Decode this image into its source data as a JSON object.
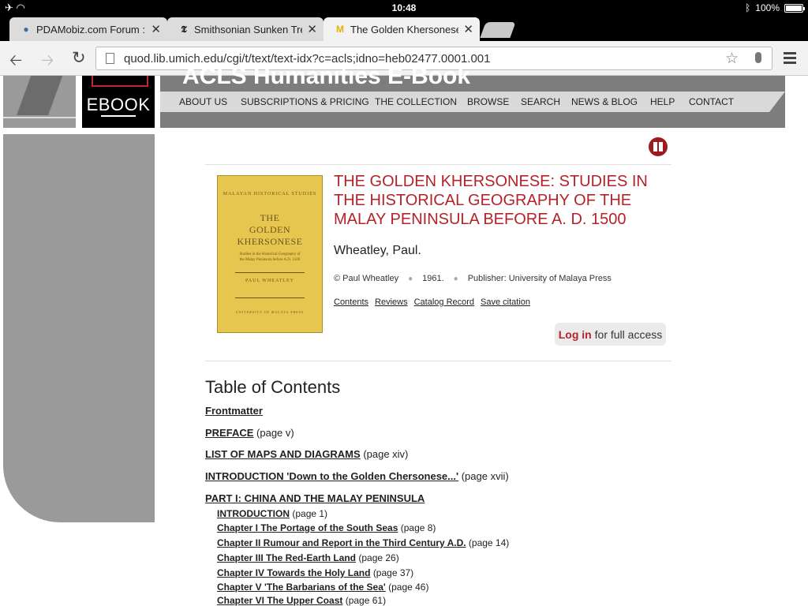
{
  "status_bar": {
    "time": "10:48",
    "battery": "100%"
  },
  "tabs": [
    {
      "favicon": "forum-favicon",
      "title": "PDAMobiz.com Forum :: n",
      "close": "✕"
    },
    {
      "favicon": "nyt-favicon",
      "title": "Smithsonian Sunken Trea",
      "close": "✕"
    },
    {
      "favicon": "umich-favicon",
      "title": "The Golden Khersonese: s",
      "close": "✕"
    }
  ],
  "toolbar": {
    "url": "quod.lib.umich.edu/cgi/t/text/text-idx?c=acls;idno=heb02477.0001.001"
  },
  "header": {
    "banner_title": "ACLS Humanities E-Book",
    "logo_text": "EBOOK",
    "nav": [
      "ABOUT US",
      "SUBSCRIPTIONS & PRICING",
      "THE COLLECTION",
      "BROWSE",
      "SEARCH",
      "NEWS & BLOG",
      "HELP",
      "CONTACT"
    ]
  },
  "book": {
    "cover": {
      "series": "MALAYAN HISTORICAL STUDIES",
      "title_lines": [
        "THE",
        "GOLDEN",
        "KHERSONESE"
      ],
      "subtitle": "Studies in the Historical Geography of the Malay Peninsula before A.D. 1500",
      "author": "PAUL WHEATLEY",
      "publisher": "UNIVERSITY OF MALAYA PRESS"
    },
    "title": "THE GOLDEN KHERSONESE: STUDIES IN THE HISTORICAL GEOGRAPHY OF THE MALAY PENINSULA BEFORE A. D. 1500",
    "author": "Wheatley, Paul.",
    "copyright": "© Paul Wheatley",
    "year": "1961.",
    "publisher": "Publisher: University of Malaya Press",
    "links": [
      "Contents",
      "Reviews",
      "Catalog Record",
      "Save citation"
    ],
    "login_label": "Log in",
    "login_suffix": "for full access"
  },
  "toc": {
    "heading": "Table of Contents",
    "entries": [
      {
        "label": "Frontmatter",
        "page": ""
      },
      {
        "label": "PREFACE",
        "page": "(page v)"
      },
      {
        "label": "LIST OF MAPS AND DIAGRAMS",
        "page": "(page xiv)"
      },
      {
        "label": "INTRODUCTION 'Down to the Golden Chersonese...'",
        "page": "(page xvii)"
      },
      {
        "label": "PART I: CHINA AND THE MALAY PENINSULA",
        "page": ""
      }
    ],
    "subentries": [
      {
        "label": "INTRODUCTION",
        "page": "(page 1)"
      },
      {
        "label": "Chapter I The Portage of the South Seas",
        "page": "(page 8)"
      },
      {
        "label": "Chapter II Rumour and Report in the Third Century A.D.",
        "page": "(page 14)"
      },
      {
        "label": "Chapter III The Red-Earth Land",
        "page": "(page 26)"
      },
      {
        "label": "Chapter IV Towards the Holy Land",
        "page": "(page 37)"
      },
      {
        "label": "Chapter V 'The Barbarians of the Sea'",
        "page": "(page 46)"
      },
      {
        "label": "Chapter VI The Upper Coast",
        "page": "(page 61)"
      }
    ]
  },
  "colors": {
    "accent_red": "#b3232a",
    "header_grey": "#7d7d7d",
    "nav_grey": "#d9d9d9"
  }
}
